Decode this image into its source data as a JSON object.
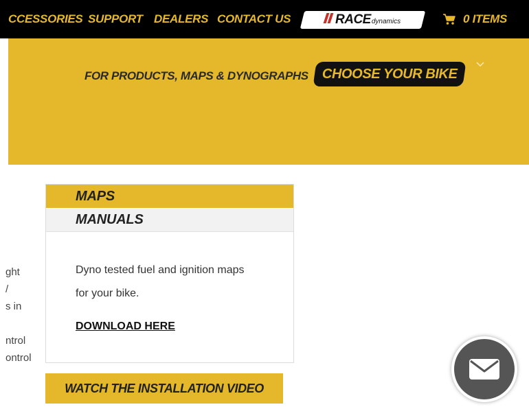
{
  "nav": {
    "items": [
      "CCESSORIES",
      "SUPPORT",
      "DEALERS",
      "CONTACT US"
    ],
    "logo": {
      "race": "RACE",
      "dynamics": "dynamics"
    },
    "cart_label": "0 ITEMS",
    "cart_icon": "cart-icon"
  },
  "banner": {
    "text": "FOR PRODUCTS, MAPS & DYNOGRAPHS",
    "button": "CHOOSE YOUR BIKE",
    "chevron_icon": "chevron-down-icon"
  },
  "side_text": [
    "ght",
    "/",
    "s in",
    "ntrol",
    "ontrol"
  ],
  "panel": {
    "tabs": [
      "MAPS",
      "MANUALS"
    ],
    "active_tab": "MAPS",
    "description_line1": "Dyno tested fuel and ignition maps",
    "description_line2": "for your bike.",
    "download_link": "DOWNLOAD HERE"
  },
  "video_button": "WATCH THE INSTALLATION VIDEO",
  "chat_icon": "mail-icon",
  "colors": {
    "accent": "#e4b82a",
    "nav_bg": "#000000",
    "chat_bg": "#555555"
  }
}
